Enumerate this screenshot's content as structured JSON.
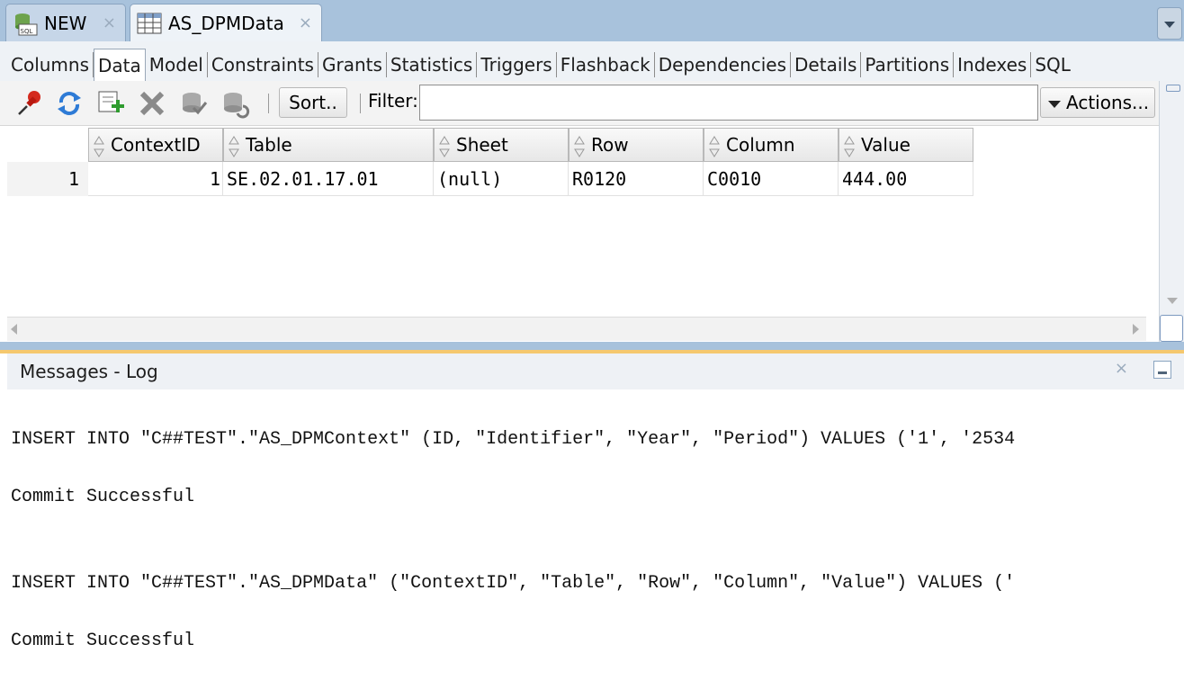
{
  "doc_tabs": [
    {
      "label": "NEW",
      "icon": "sql-worksheet-icon",
      "close": "×"
    },
    {
      "label": "AS_DPMData",
      "icon": "table-icon",
      "close": "×"
    }
  ],
  "sub_tabs": [
    "Columns",
    "Data",
    "Model",
    "Constraints",
    "Grants",
    "Statistics",
    "Triggers",
    "Flashback",
    "Dependencies",
    "Details",
    "Partitions",
    "Indexes",
    "SQL"
  ],
  "active_sub_tab": "Data",
  "toolbar": {
    "sort_label": "Sort..",
    "filter_label": "Filter:",
    "filter_value": "",
    "actions_label": "Actions..."
  },
  "grid": {
    "columns": [
      "ContextID",
      "Table",
      "Sheet",
      "Row",
      "Column",
      "Value"
    ],
    "rows": [
      {
        "num": "1",
        "cells": [
          "1",
          "SE.02.01.17.01",
          "(null)",
          "R0120",
          "C0010",
          "444.00"
        ]
      }
    ]
  },
  "log": {
    "title": "Messages - Log",
    "close": "×",
    "lines": [
      "INSERT INTO \"C##TEST\".\"AS_DPMContext\" (ID, \"Identifier\", \"Year\", \"Period\") VALUES ('1', '2534",
      "Commit Successful",
      "INSERT INTO \"C##TEST\".\"AS_DPMData\" (\"ContextID\", \"Table\", \"Row\", \"Column\", \"Value\") VALUES ('",
      "Commit Successful"
    ]
  }
}
